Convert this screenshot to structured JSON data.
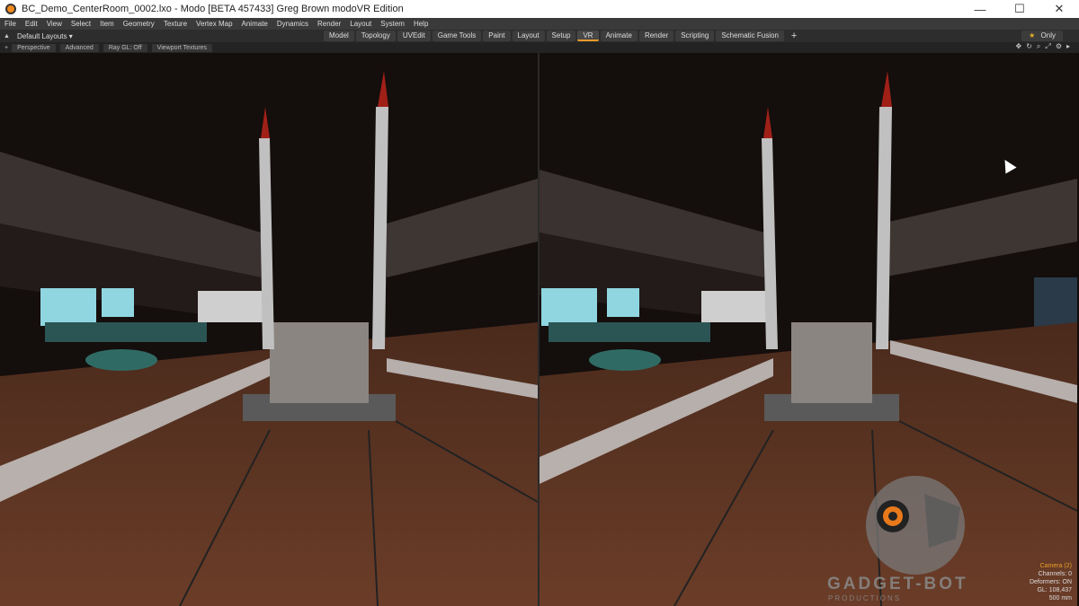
{
  "window": {
    "title": "BC_Demo_CenterRoom_0002.lxo - Modo [BETA 457433] Greg Brown  modoVR Edition",
    "controls": [
      "—",
      "☐",
      "✕"
    ]
  },
  "menu": [
    "File",
    "Edit",
    "View",
    "Select",
    "Item",
    "Geometry",
    "Texture",
    "Vertex Map",
    "Animate",
    "Dynamics",
    "Render",
    "Layout",
    "System",
    "Help"
  ],
  "toolbar": {
    "layout_label": "Default Layouts ▾",
    "tabs": [
      "Model",
      "Topology",
      "UVEdit",
      "Game Tools",
      "Paint",
      "Layout",
      "Setup",
      "VR",
      "Animate",
      "Render",
      "Scripting",
      "Schematic Fusion"
    ],
    "active_tab": "VR",
    "add_tab": "+",
    "only_label": "Only"
  },
  "viewport_toolbar": {
    "buttons": [
      "Perspective",
      "Advanced",
      "Ray GL: Off",
      "Viewport Textures"
    ]
  },
  "hud": {
    "camera": "Camera (2)",
    "channels": "Channels: 0",
    "deformers": "Deformers: ON",
    "gl": "GL: 108,437",
    "size": "500 mm"
  },
  "watermark": {
    "name": "GADGET-BOT",
    "sub": "PRODUCTIONS"
  }
}
